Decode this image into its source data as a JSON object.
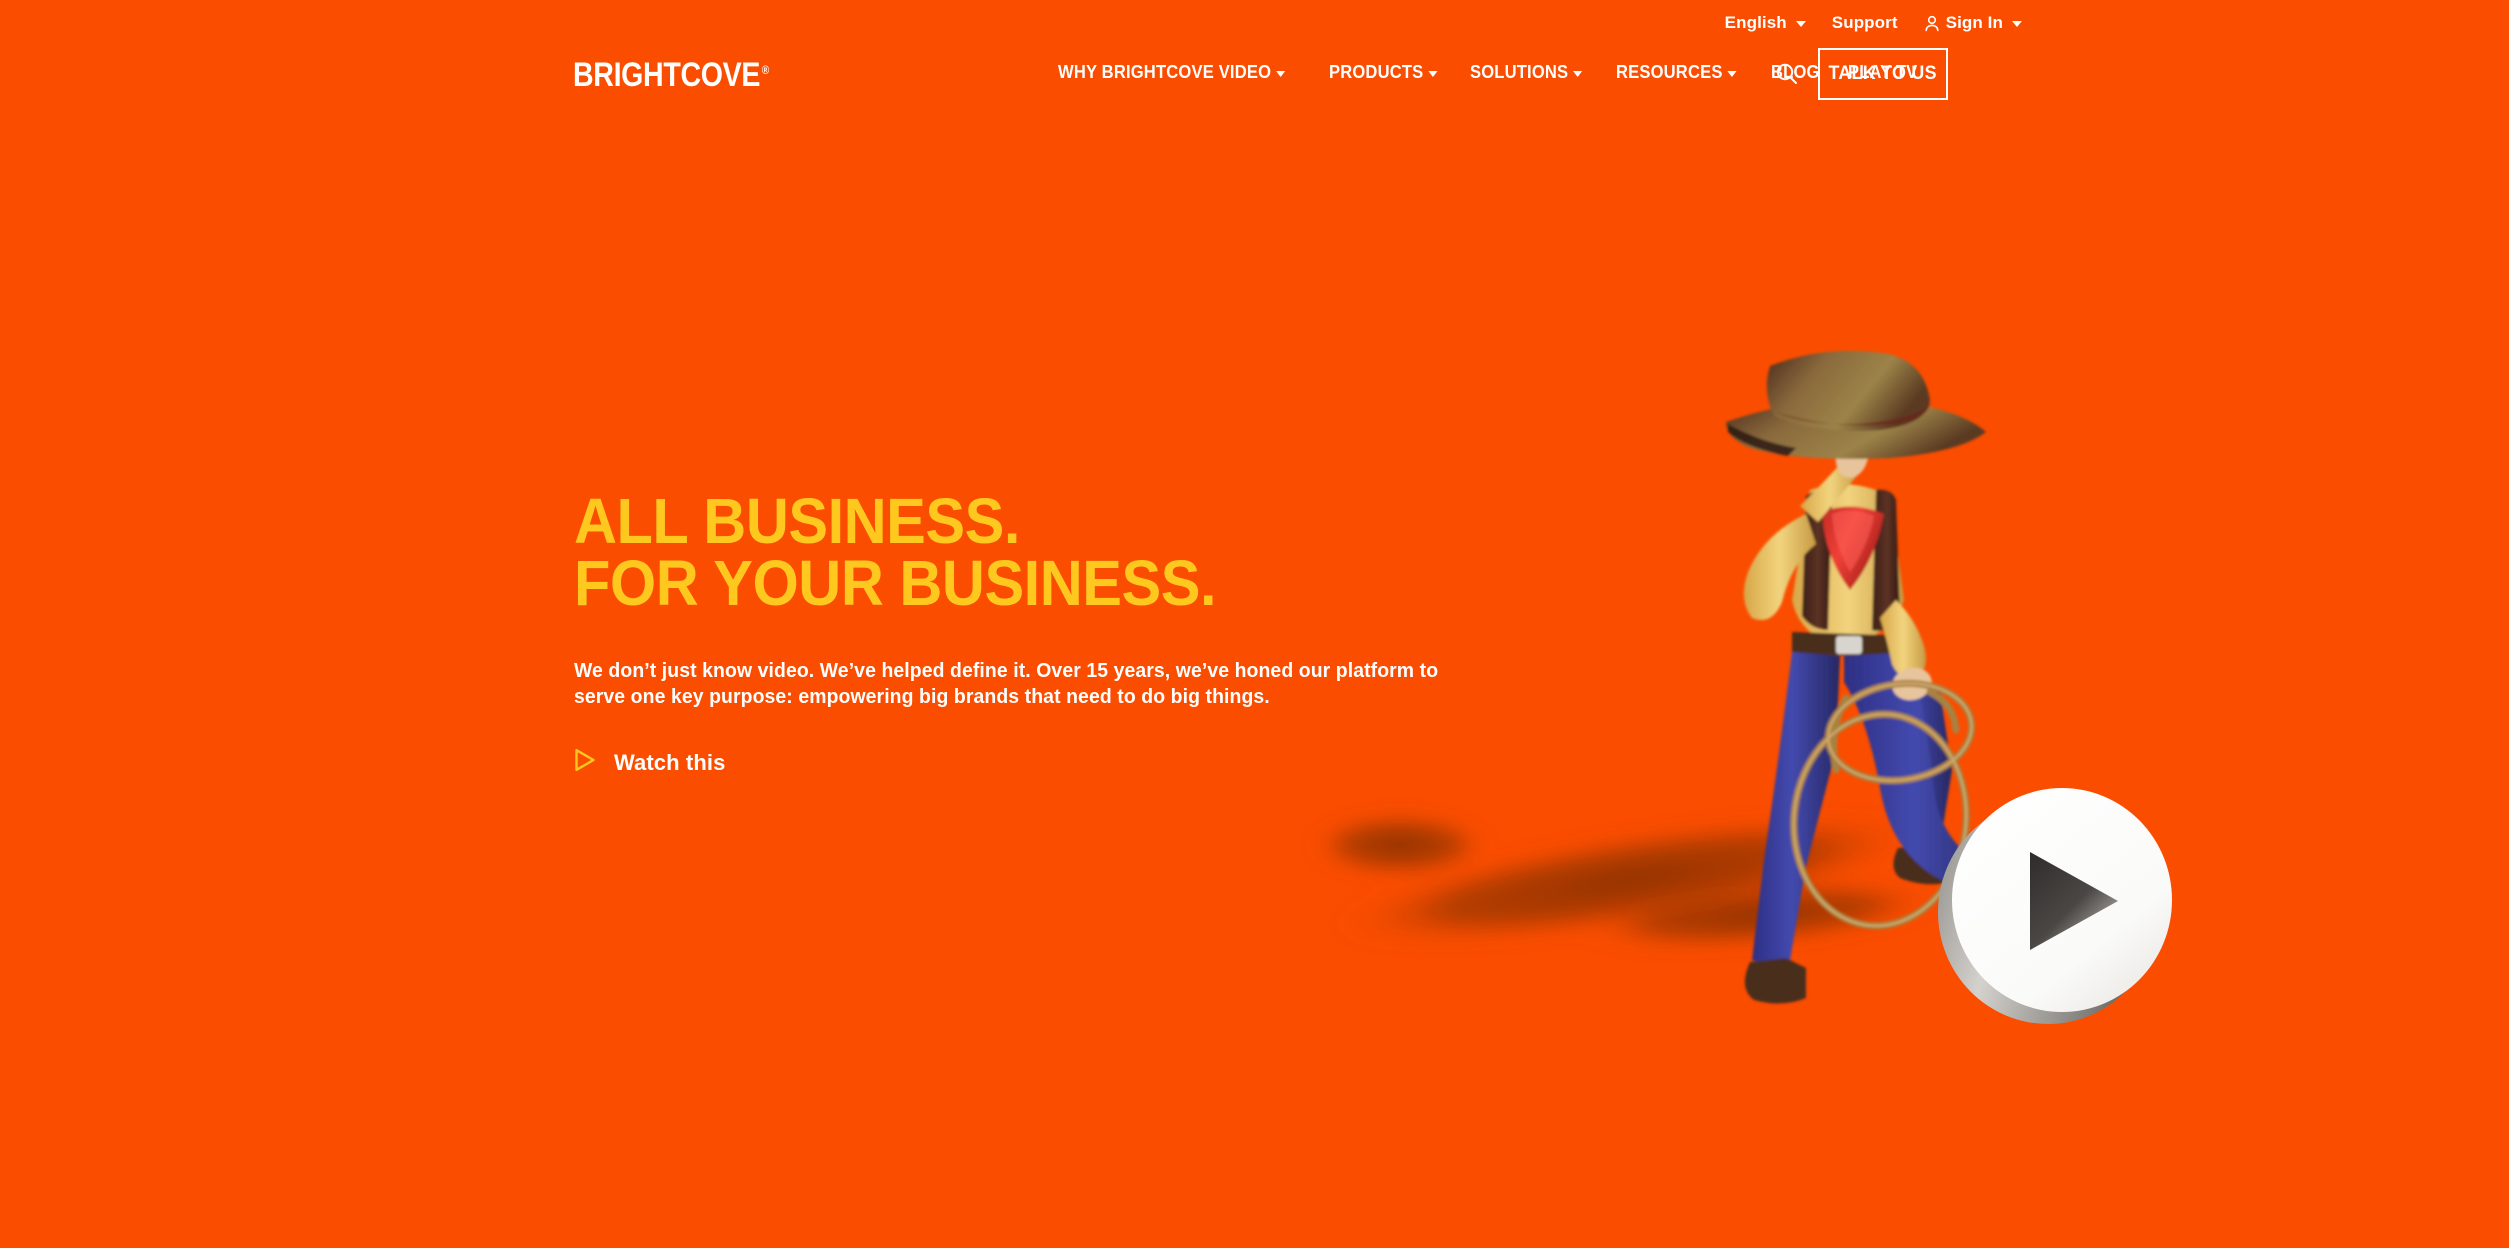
{
  "theme": {
    "background": "#FA4D00",
    "accent_yellow": "#FFC81E",
    "text_white": "#FFFFFF",
    "shadow": "#A63300"
  },
  "utility_bar": {
    "language": "English",
    "support": "Support",
    "sign_in": "Sign In"
  },
  "header": {
    "logo_text": "BRIGHTCOVE",
    "logo_trademark": "®",
    "nav": [
      {
        "label": "WHY BRIGHTCOVE VIDEO",
        "has_dropdown": true
      },
      {
        "label": "PRODUCTS",
        "has_dropdown": true
      },
      {
        "label": "SOLUTIONS",
        "has_dropdown": true
      },
      {
        "label": "RESOURCES",
        "has_dropdown": true
      },
      {
        "label": "BLOG",
        "has_dropdown": false
      },
      {
        "label": "PLAY TV",
        "has_dropdown": false
      }
    ],
    "search_icon": "search-icon",
    "cta_button": "TALK TO US"
  },
  "hero": {
    "headline_line1": "ALL BUSINESS.",
    "headline_line2": "FOR YOUR BUSINESS.",
    "subcopy": "We don’t just know video. We’ve helped define it. Over 15 years, we’ve honed our platform to serve one key purpose: empowering big brands that need to do big things.",
    "watch_label": "Watch this",
    "play_icon": "play-triangle-icon",
    "artwork": "cowboy-figurine-with-lasso-resting-foot-on-play-button-disc"
  }
}
